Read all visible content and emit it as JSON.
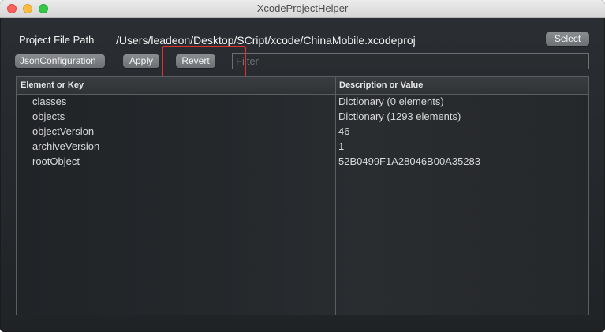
{
  "window": {
    "title": "XcodeProjectHelper"
  },
  "project": {
    "label": "Project File Path",
    "path": "/Users/leadeon/Desktop/SCript/xcode/ChinaMobile.xcodeproj",
    "select_label": "Select"
  },
  "toolbar": {
    "json_config_label": "JsonConfiguration",
    "apply_label": "Apply",
    "revert_label": "Revert",
    "filter_placeholder": "Filter",
    "filter_value": ""
  },
  "table": {
    "columns": [
      "Element or Key",
      "Description or Value"
    ],
    "rows": [
      {
        "key": "classes",
        "value": "Dictionary (0 elements)"
      },
      {
        "key": "objects",
        "value": "Dictionary (1293 elements)"
      },
      {
        "key": "objectVersion",
        "value": "46"
      },
      {
        "key": "archiveVersion",
        "value": "1"
      },
      {
        "key": "rootObject",
        "value": "52B0499F1A28046B00A35283"
      }
    ]
  },
  "colors": {
    "highlight": "#e0322b",
    "window_bg": "#262a2e",
    "button_bg": "#7c7f82",
    "text": "#f2f2f2"
  }
}
